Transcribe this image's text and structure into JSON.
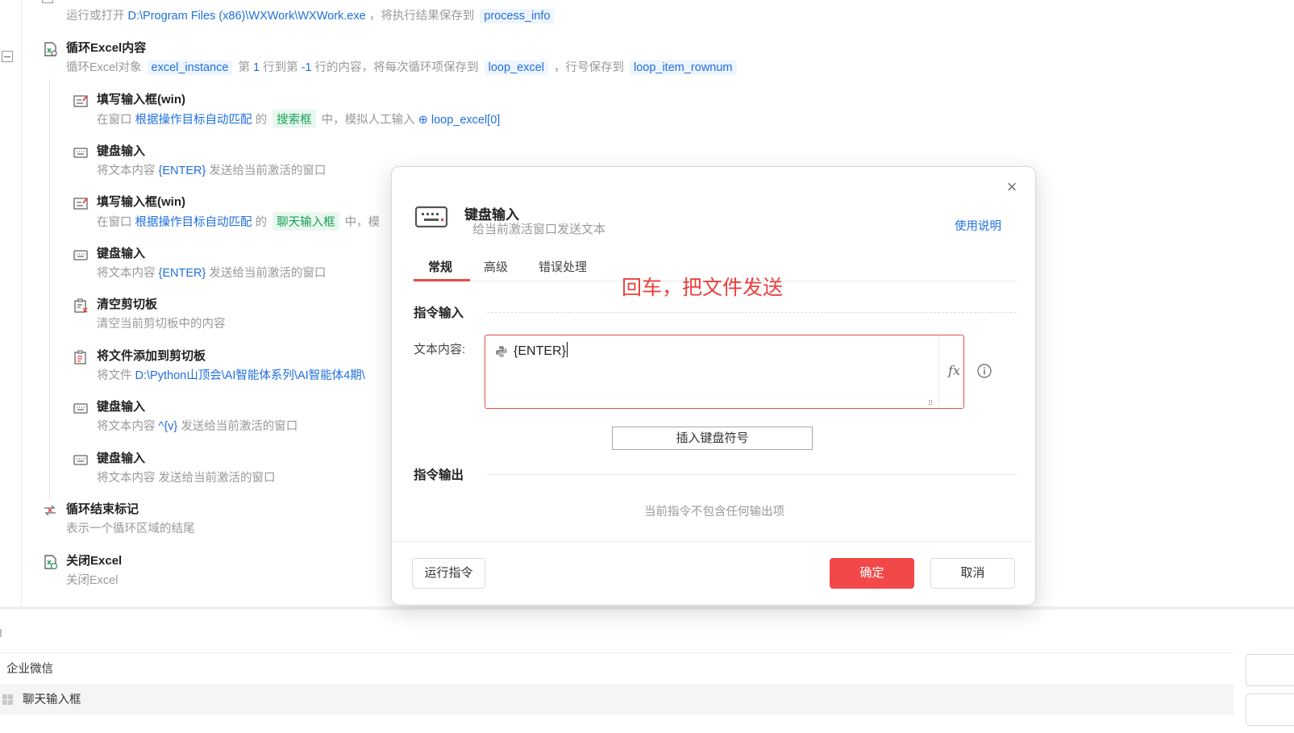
{
  "flow": {
    "top_step": {
      "desc_prefix": "运行或打开",
      "desc_path": "D:\\Program Files (x86)\\WXWork\\WXWork.exe",
      "desc_mid": "，将执行结果保存到",
      "desc_var": "process_info"
    },
    "loop_excel": {
      "title": "循环Excel内容",
      "d1": "循环Excel对象",
      "var1": "excel_instance",
      "d2": "第",
      "n1": "1",
      "d3": "行到第",
      "n2": "-1",
      "d4": "行的内容，将每次循环项保存到",
      "var2": "loop_excel",
      "d5": "，行号保存到",
      "var3": "loop_item_rownum"
    },
    "fill1": {
      "title": "填写输入框(win)",
      "d1": "在窗口",
      "link": "根据操作目标自动匹配",
      "d2": "的",
      "tag": "搜索框",
      "d3": "中，模拟人工输入",
      "var": "loop_excel[0]"
    },
    "kb1": {
      "title": "键盘输入",
      "d1": "将文本内容",
      "key": "{ENTER}",
      "d2": "发送给当前激活的窗口"
    },
    "fill2": {
      "title": "填写输入框(win)",
      "d1": "在窗口",
      "link": "根据操作目标自动匹配",
      "d2": "的",
      "tag": "聊天输入框",
      "d3": "中，模"
    },
    "kb2": {
      "title": "键盘输入",
      "d1": "将文本内容",
      "key": "{ENTER}",
      "d2": "发送给当前激活的窗口"
    },
    "clear_clip": {
      "title": "清空剪切板",
      "desc": "清空当前剪切板中的内容"
    },
    "add_clip": {
      "title": "将文件添加到剪切板",
      "d1": "将文件",
      "path": "D:\\Python山顶会\\AI智能体系列\\AI智能体4期\\"
    },
    "kb3": {
      "title": "键盘输入",
      "d1": "将文本内容",
      "key": "^{v}",
      "d2": "发送给当前激活的窗口"
    },
    "kb4": {
      "title": "键盘输入",
      "desc": "将文本内容 发送给当前激活的窗口"
    },
    "loop_end": {
      "title": "循环结束标记",
      "desc": "表示一个循环区域的结尾"
    },
    "close_excel": {
      "title": "关闭Excel",
      "desc": "关闭Excel"
    }
  },
  "bottom": {
    "row1": "企业微信",
    "row2": "聊天输入框"
  },
  "modal": {
    "title": "键盘输入",
    "subtitle": "给当前激活窗口发送文本",
    "help": "使用说明",
    "close_glyph": "×",
    "tabs": [
      "常规",
      "高级",
      "错误处理"
    ],
    "active_tab": "常规",
    "annotation": "回车，把文件发送",
    "input_section": "指令输入",
    "field_label": "文本内容:",
    "field_value": "{ENTER}",
    "fx": "fx",
    "insert_button": "插入键盘符号",
    "output_section": "指令输出",
    "no_output": "当前指令不包含任何输出项",
    "run_button": "运行指令",
    "ok_button": "确定",
    "cancel_button": "取消"
  },
  "colors": {
    "accent": "#f2484a",
    "link": "#1f6fe0",
    "green_tag": "#18a058",
    "annotation": "#e8403f"
  }
}
